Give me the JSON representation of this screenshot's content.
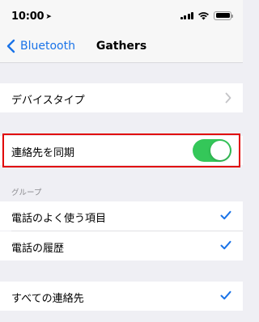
{
  "status_bar": {
    "time": "10:00",
    "location_icon": "location-arrow-icon",
    "signal_icon": "cellular-signal-icon",
    "wifi_icon": "wifi-icon",
    "battery_icon": "battery-icon"
  },
  "nav": {
    "back_label": "Bluetooth",
    "title": "Gathers"
  },
  "device_type": {
    "label": "デバイスタイプ"
  },
  "sync_contacts": {
    "label": "連絡先を同期",
    "enabled": true
  },
  "groups": {
    "header": "グループ",
    "items": [
      {
        "label": "電話のよく使う項目",
        "checked": true
      },
      {
        "label": "電話の履歴",
        "checked": true
      }
    ]
  },
  "all_contacts": {
    "label": "すべての連絡先",
    "checked": true
  },
  "colors": {
    "accent": "#1a73e8",
    "toggle_on": "#34c759",
    "highlight": "#e00000",
    "background": "#efeff4"
  }
}
